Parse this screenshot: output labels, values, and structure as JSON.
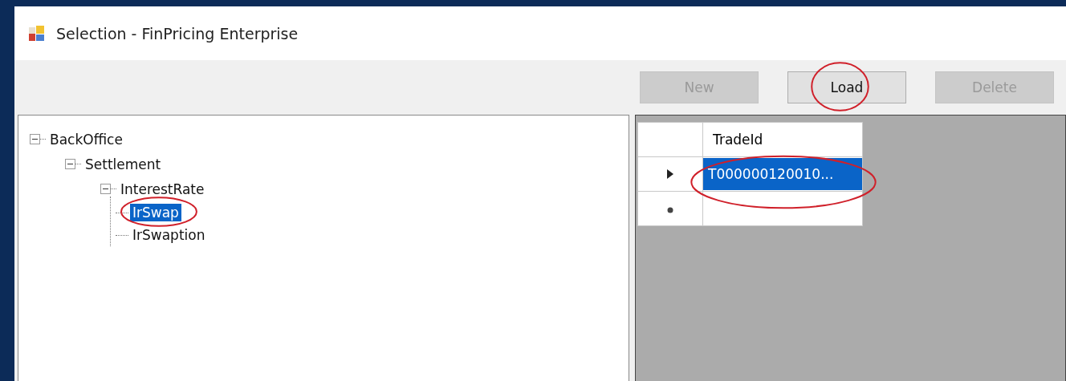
{
  "window": {
    "title": "Selection - FinPricing Enterprise"
  },
  "toolbar": {
    "buttons": [
      {
        "label": "New",
        "disabled": true,
        "circled": false
      },
      {
        "label": "Load",
        "disabled": false,
        "circled": true
      },
      {
        "label": "Delete",
        "disabled": true,
        "circled": false
      }
    ]
  },
  "tree": [
    {
      "label": "BackOffice",
      "expanded": true,
      "selected": false,
      "circled": false,
      "children": [
        {
          "label": "Settlement",
          "expanded": true,
          "selected": false,
          "circled": false,
          "children": [
            {
              "label": "InterestRate",
              "expanded": true,
              "selected": false,
              "circled": false,
              "children": [
                {
                  "label": "IrSwap",
                  "selected": true,
                  "circled": true
                },
                {
                  "label": "IrSwaption",
                  "selected": false,
                  "circled": false
                }
              ]
            }
          ]
        }
      ]
    }
  ],
  "grid": {
    "columns": [
      "TradeId"
    ],
    "rows": [
      {
        "cells": [
          "T000000120010..."
        ],
        "current": true,
        "selected": true,
        "circled": true
      }
    ],
    "new_row": true
  }
}
